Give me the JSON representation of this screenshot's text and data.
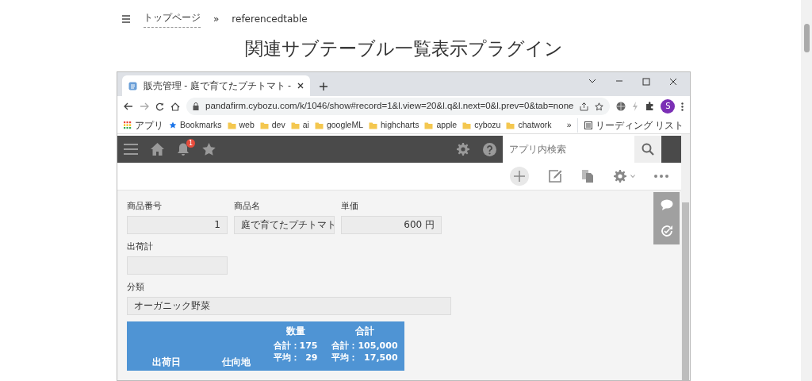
{
  "page": {
    "breadcrumb": [
      {
        "label": "トップページ"
      },
      {
        "label": "referencedtable"
      }
    ],
    "separator": "»",
    "title": "関連サブテーブル一覧表示プラグイン"
  },
  "browser": {
    "tab_title": "販売管理 - 庭で育てたプチトマト -",
    "url": "pandafirm.cybozu.com/k/1046/show#record=1&l.view=20&l.q&l.next=0&l.prev=0&tab=none",
    "profile_initial": "S",
    "bookmarks": [
      {
        "kind": "apps",
        "label": "アプリ"
      },
      {
        "kind": "star",
        "label": "Bookmarks"
      },
      {
        "kind": "folder",
        "label": "web"
      },
      {
        "kind": "folder",
        "label": "dev"
      },
      {
        "kind": "folder",
        "label": "ai"
      },
      {
        "kind": "folder",
        "label": "googleML"
      },
      {
        "kind": "folder",
        "label": "highcharts"
      },
      {
        "kind": "folder",
        "label": "apple"
      },
      {
        "kind": "folder",
        "label": "cybozu"
      },
      {
        "kind": "folder",
        "label": "chatwork"
      }
    ],
    "overflow": "»",
    "reading_list": "リーディング リスト"
  },
  "app": {
    "notification_count": "1",
    "search": {
      "placeholder": "アプリ内検索"
    },
    "field_rows": [
      [
        {
          "kind": "number",
          "label": "商品番号",
          "value": "1"
        },
        {
          "kind": "text",
          "label": "商品名",
          "value": "庭で育てたプチトマト"
        },
        {
          "kind": "number",
          "label": "単価",
          "value": "600 円"
        }
      ],
      [
        {
          "kind": "number",
          "label": "出荷計"
        }
      ],
      [
        {
          "kind": "dropdown",
          "label": "分類",
          "value": "オーガニック野菜"
        }
      ]
    ],
    "table": {
      "columns": [
        {
          "label": "出荷日"
        },
        {
          "label": "仕向地"
        },
        {
          "label": "数量",
          "summary": [
            "合計：175",
            "平均：  29"
          ]
        },
        {
          "label": "合計",
          "summary": [
            "合計：105,000",
            "平均：  17,500"
          ]
        }
      ]
    }
  }
}
